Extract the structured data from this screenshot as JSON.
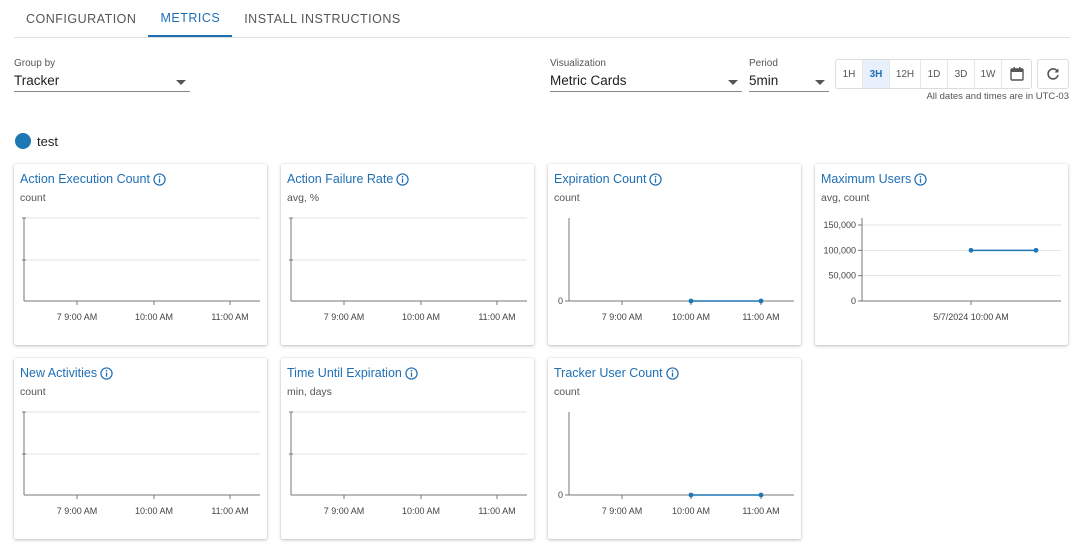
{
  "tabs": [
    {
      "label": "CONFIGURATION",
      "active": false
    },
    {
      "label": "METRICS",
      "active": true
    },
    {
      "label": "INSTALL INSTRUCTIONS",
      "active": false
    }
  ],
  "group_by": {
    "label": "Group by",
    "value": "Tracker"
  },
  "visualization": {
    "label": "Visualization",
    "value": "Metric Cards"
  },
  "period": {
    "label": "Period",
    "value": "5min"
  },
  "ranges": [
    {
      "label": "1H",
      "active": false
    },
    {
      "label": "3H",
      "active": true
    },
    {
      "label": "12H",
      "active": false
    },
    {
      "label": "1D",
      "active": false
    },
    {
      "label": "3D",
      "active": false
    },
    {
      "label": "1W",
      "active": false
    }
  ],
  "icons": {
    "calendar": "calendar-icon",
    "refresh": "refresh-icon",
    "info": "info-icon"
  },
  "timezone_note": "All dates and times are in UTC-03",
  "legend": {
    "label": "test",
    "color": "#1f77b4"
  },
  "colors": {
    "accent": "#1f6fb4",
    "series": "#1f77b4"
  },
  "cards": [
    {
      "title": "Action Execution Count",
      "subtitle": "count",
      "y_ticks": [],
      "x_ticks": [
        "7 9:00 AM",
        "10:00 AM",
        "11:00 AM"
      ],
      "points": []
    },
    {
      "title": "Action Failure Rate",
      "subtitle": "avg, %",
      "y_ticks": [],
      "x_ticks": [
        "7 9:00 AM",
        "10:00 AM",
        "11:00 AM"
      ],
      "points": []
    },
    {
      "title": "Expiration Count",
      "subtitle": "count",
      "y_ticks": [
        "0"
      ],
      "x_ticks": [
        "7 9:00 AM",
        "10:00 AM",
        "11:00 AM"
      ],
      "points": [
        {
          "x": "10:00 AM",
          "y": 0
        },
        {
          "x": "11:00 AM",
          "y": 0
        }
      ]
    },
    {
      "title": "Maximum Users",
      "subtitle": "avg, count",
      "y_ticks": [
        "150,000",
        "100,000",
        "50,000",
        "0"
      ],
      "x_ticks": [
        "5/7/2024 10:00 AM"
      ],
      "points": [
        {
          "x": "5/7/2024 10:00 AM",
          "y": 100000
        },
        {
          "x": "11:00 AM",
          "y": 100000
        }
      ]
    },
    {
      "title": "New Activities",
      "subtitle": "count",
      "y_ticks": [],
      "x_ticks": [
        "7 9:00 AM",
        "10:00 AM",
        "11:00 AM"
      ],
      "points": []
    },
    {
      "title": "Time Until Expiration",
      "subtitle": "min, days",
      "y_ticks": [],
      "x_ticks": [
        "7 9:00 AM",
        "10:00 AM",
        "11:00 AM"
      ],
      "points": []
    },
    {
      "title": "Tracker User Count",
      "subtitle": "count",
      "y_ticks": [
        "0"
      ],
      "x_ticks": [
        "7 9:00 AM",
        "10:00 AM",
        "11:00 AM"
      ],
      "points": [
        {
          "x": "10:00 AM",
          "y": 0
        },
        {
          "x": "11:00 AM",
          "y": 0
        }
      ]
    }
  ]
}
